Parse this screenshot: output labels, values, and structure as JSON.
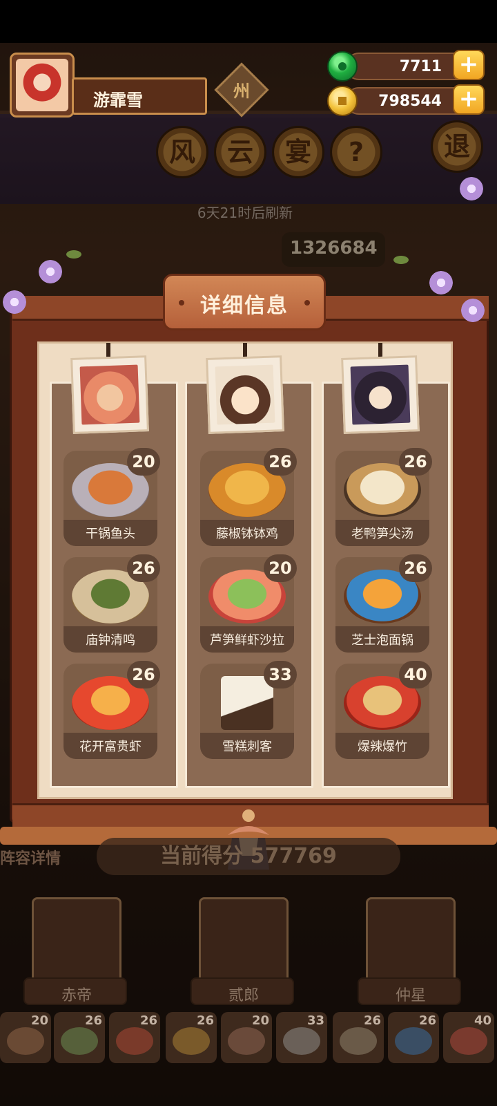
{
  "player": {
    "name": "游霏雪"
  },
  "region_tag": "州",
  "currency": {
    "jade": {
      "icon": "jade-icon",
      "value": "7711",
      "color": "#1fae40"
    },
    "coin": {
      "icon": "coin-icon",
      "value": "798544",
      "color": "#f3c23a"
    }
  },
  "title_chars": [
    "风",
    "云",
    "宴",
    "?"
  ],
  "exit_label": "退",
  "refresh_text": "6天21时后刷新",
  "top_score": "1326684",
  "panel": {
    "title": "详细信息",
    "columns": [
      {
        "character": "赤帝",
        "portrait_color": "#e9a07a",
        "dishes": [
          {
            "name": "干锅鱼头",
            "score": "20",
            "color": "#c6783e"
          },
          {
            "name": "庙钟清鸣",
            "score": "26",
            "color": "#8aa44a"
          },
          {
            "name": "花开富贵虾",
            "score": "26",
            "color": "#e6703b"
          }
        ]
      },
      {
        "character": "贰郎",
        "portrait_color": "#f3d9bd",
        "dishes": [
          {
            "name": "藤椒钵钵鸡",
            "score": "26",
            "color": "#e0993a"
          },
          {
            "name": "芦笋鲜虾沙拉",
            "score": "20",
            "color": "#e26a53"
          },
          {
            "name": "雪糕刺客",
            "score": "33",
            "color": "#e8dcc6"
          }
        ]
      },
      {
        "character": "仲星",
        "portrait_color": "#4a3b5a",
        "dishes": [
          {
            "name": "老鸭笋尖汤",
            "score": "26",
            "color": "#d9b27a"
          },
          {
            "name": "芝士泡面锅",
            "score": "26",
            "color": "#3a86c4"
          },
          {
            "name": "爆辣爆竹",
            "score": "40",
            "color": "#d8412e"
          }
        ]
      }
    ]
  },
  "bottom": {
    "lineup_label": "阵容详情",
    "current_score": "当前得分 577769",
    "characters": [
      "赤帝",
      "贰郎",
      "仲星"
    ],
    "mini_scores": [
      "20",
      "26",
      "26",
      "26",
      "20",
      "33",
      "26",
      "26",
      "40"
    ]
  }
}
